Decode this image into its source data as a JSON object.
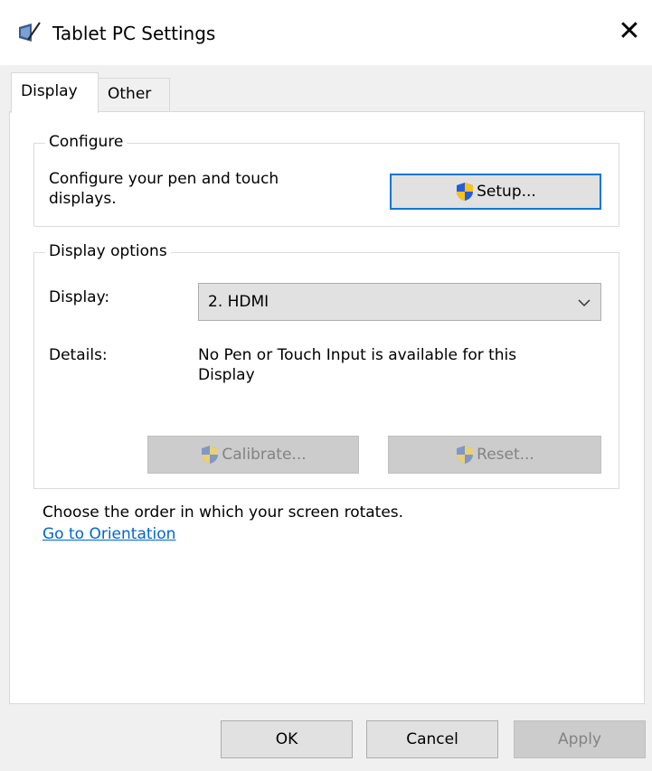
{
  "window": {
    "title": "Tablet PC Settings",
    "icon": "tablet-pen-icon",
    "close_glyph": "✕"
  },
  "tabs": [
    {
      "label": "Display",
      "selected": true
    },
    {
      "label": "Other",
      "selected": false
    }
  ],
  "configure": {
    "legend": "Configure",
    "description_line1": "Configure your pen and touch",
    "description_line2": "displays.",
    "setup_label": "Setup..."
  },
  "display_options": {
    "legend": "Display options",
    "display_label": "Display:",
    "display_value": "2. HDMI",
    "details_label": "Details:",
    "details_line1": "No Pen or Touch Input is available for this",
    "details_line2": "Display",
    "calibrate_label": "Calibrate...",
    "reset_label": "Reset..."
  },
  "orientation": {
    "text": "Choose the order in which your screen rotates.",
    "link": "Go to Orientation"
  },
  "footer": {
    "ok": "OK",
    "cancel": "Cancel",
    "apply": "Apply"
  },
  "colors": {
    "accent": "#0078d7",
    "link": "#0066cc",
    "shield_blue": "#2a5bd7",
    "shield_yellow": "#f6c21b"
  }
}
